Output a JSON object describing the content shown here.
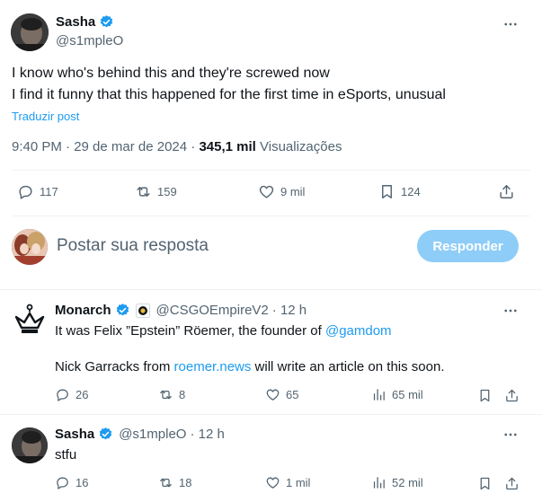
{
  "main_post": {
    "author": {
      "name": "Sasha",
      "handle": "@s1mpleO"
    },
    "lines": [
      "I know who's behind this and they're screwed now",
      "I find it funny that this happened for the first time in eSports, unusual"
    ],
    "translate": "Traduzir post",
    "meta": {
      "time": "9:40 PM · 29 de mar de 2024 · ",
      "views_count": "345,1 mil",
      "views_label": " Visualizações"
    },
    "stats": {
      "replies": "117",
      "reposts": "159",
      "likes": "9 mil",
      "bookmarks": "124"
    }
  },
  "composer": {
    "placeholder": "Postar sua resposta",
    "button": "Responder"
  },
  "replies": [
    {
      "author": {
        "name": "Monarch",
        "handle": "@CSGOEmpireV2",
        "time": "· 12 h"
      },
      "line1_prefix": "It was Felix ”Epstein” Röemer, the founder of ",
      "line1_link": "@gamdom",
      "line2_prefix": "Nick Garracks from ",
      "line2_link": "roemer.news",
      "line2_suffix": " will write an article on this soon.",
      "stats": {
        "replies": "26",
        "reposts": "8",
        "likes": "65",
        "views": "65 mil"
      }
    },
    {
      "author": {
        "name": "Sasha",
        "handle": "@s1mpleO",
        "time": "· 12 h"
      },
      "text": "stfu",
      "stats": {
        "replies": "16",
        "reposts": "18",
        "likes": "1 mil",
        "views": "52 mil"
      }
    }
  ],
  "colors": {
    "accent": "#1d9bf0",
    "verified": "#1d9bf0",
    "muted": "#536471",
    "button_disabled": "#8ecdf8"
  }
}
